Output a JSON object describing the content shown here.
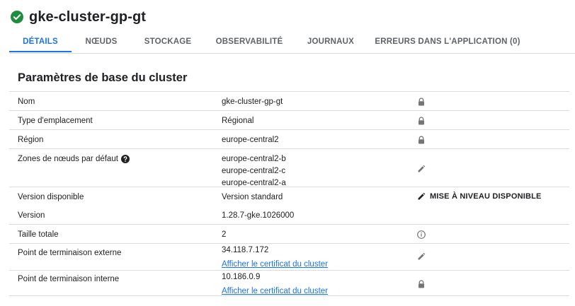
{
  "header": {
    "title": "gke-cluster-gp-gt",
    "status_color": "#1e8e3e"
  },
  "tabs": [
    {
      "label": "DÉTAILS"
    },
    {
      "label": "NŒUDS"
    },
    {
      "label": "STOCKAGE"
    },
    {
      "label": "OBSERVABILITÉ"
    },
    {
      "label": "JOURNAUX"
    },
    {
      "label": "ERREURS DANS L'APPLICATION (0)"
    }
  ],
  "section": {
    "title": "Paramètres de base du cluster"
  },
  "rows": {
    "nom": {
      "label": "Nom",
      "value": "gke-cluster-gp-gt",
      "icon": "lock-icon"
    },
    "type": {
      "label": "Type d'emplacement",
      "value": "Régional",
      "icon": "lock-icon"
    },
    "region": {
      "label": "Région",
      "value": "europe-central2",
      "icon": "lock-icon"
    },
    "zones": {
      "label": "Zones de nœuds par défaut",
      "values": [
        "europe-central2-b",
        "europe-central2-c",
        "europe-central2-a"
      ],
      "icon": "pencil-icon"
    },
    "version_dispo": {
      "label": "Version disponible",
      "value": "Version standard",
      "action": "MISE À NIVEAU DISPONIBLE"
    },
    "version": {
      "label": "Version",
      "value": "1.28.7-gke.1026000"
    },
    "taille": {
      "label": "Taille totale",
      "value": "2",
      "icon": "info-icon"
    },
    "externe": {
      "label": "Point de terminaison externe",
      "value": "34.118.7.172",
      "link": "Afficher le certificat du cluster",
      "icon": "pencil-icon"
    },
    "interne": {
      "label": "Point de terminaison interne",
      "value": "10.186.0.9",
      "link": "Afficher le certificat du cluster",
      "icon": "lock-icon"
    }
  },
  "colors": {
    "accent": "#1a73e8",
    "text": "#202124",
    "muted": "#5f6368",
    "icon": "#757575",
    "divider": "#dadce0"
  }
}
